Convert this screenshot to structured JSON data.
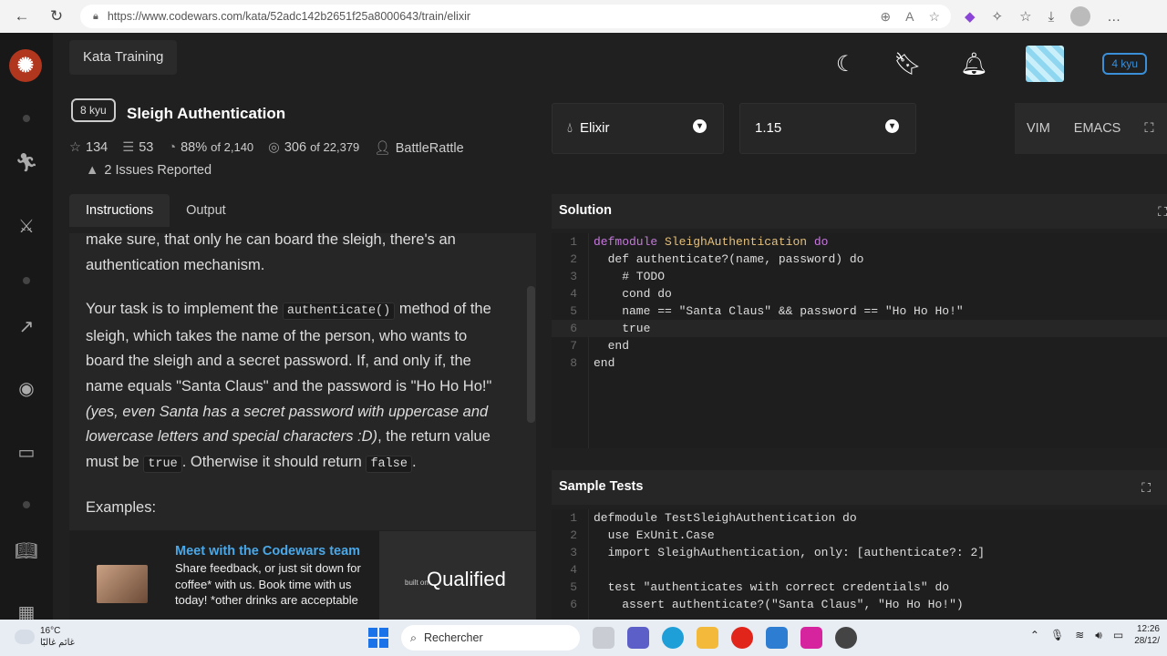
{
  "browser": {
    "url": "https://www.codewars.com/kata/52adc142b2651f25a8000643/train/elixir"
  },
  "header": {
    "section": "Kata Training",
    "kyu": "4 kyu"
  },
  "kata": {
    "rank": "8 kyu",
    "title": "Sleigh Authentication",
    "stars": "134",
    "collections": "53",
    "satisfaction": "88%",
    "satisfaction_of": "of 2,140",
    "completed": "306",
    "completed_of": "of 22,379",
    "author": "BattleRattle",
    "issues": "2 Issues Reported"
  },
  "tabs": {
    "instructions": "Instructions",
    "output": "Output"
  },
  "description": {
    "p1": "make sure, that only he can board the sleigh, there's an authentication mechanism.",
    "p2a": "Your task is to implement the ",
    "p2code1": "authenticate()",
    "p2b": " method of the sleigh, which takes the name of the person, who wants to board the sleigh and a secret password. If, and only if, the name equals \"Santa Claus\" and the password is \"Ho Ho Ho!\" ",
    "p2em": "(yes, even Santa has a secret password with uppercase and lowercase letters and special characters :D)",
    "p2c": ", the return value must be ",
    "p2code2": "true",
    "p2d": ". Otherwise it should return ",
    "p2code3": "false",
    "p2e": ".",
    "examples": "Examples:"
  },
  "promo": {
    "title": "Meet with the Codewars team",
    "body": "Share feedback, or just sit down for coffee* with us. Book time with us today! *other drinks are acceptable",
    "built_on": "built on",
    "brand": "Qualified"
  },
  "language": {
    "selected": "Elixir",
    "version": "1.15"
  },
  "modes": {
    "vim": "VIM",
    "emacs": "EMACS"
  },
  "solution": {
    "title": "Solution",
    "lines": [
      "defmodule SleighAuthentication do",
      "  def authenticate?(name, password) do",
      "    # TODO",
      "    cond do",
      "    name == \"Santa Claus\" && password == \"Ho Ho Ho!\"",
      "    true",
      "  end",
      "end"
    ]
  },
  "sample_tests": {
    "title": "Sample Tests",
    "lines": [
      "defmodule TestSleighAuthentication do",
      "  use ExUnit.Case",
      "  import SleighAuthentication, only: [authenticate?: 2]",
      "",
      "  test \"authenticates with correct credentials\" do",
      "    assert authenticate?(\"Santa Claus\", \"Ho Ho Ho!\")"
    ]
  },
  "taskbar": {
    "temperature": "16°C",
    "weather": "غائم غالبًا",
    "search": "Rechercher",
    "time": "12:26",
    "date": "28/12/"
  },
  "colors": {
    "accent": "#b1361e",
    "link": "#4aa8e8",
    "kyu_blue": "#3a8fd8"
  }
}
